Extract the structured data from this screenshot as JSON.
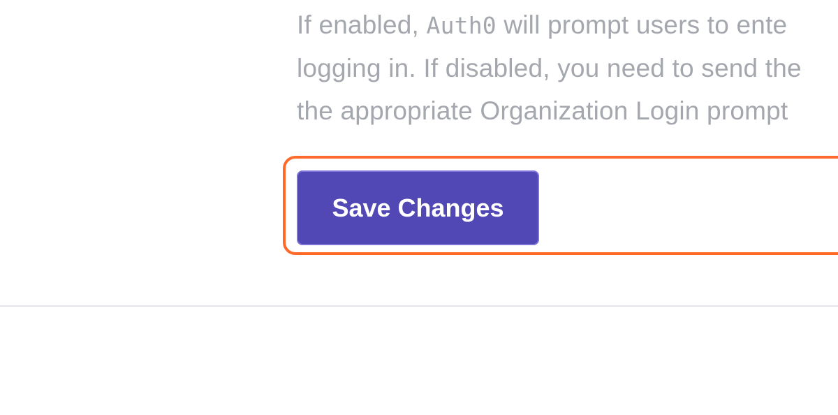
{
  "settings_section": {
    "description_lines": [
      {
        "before": "If enabled, ",
        "mono": "Auth0",
        "after": " will prompt users to ente"
      },
      {
        "text": "logging in. If disabled, you need to send the"
      },
      {
        "text": "the appropriate Organization Login prompt"
      }
    ],
    "save_button_label": "Save Changes"
  },
  "colors": {
    "description_text": "#a4a7ad",
    "button_background": "#5248b5",
    "button_text": "#ffffff",
    "highlight_border": "#ff6a2b",
    "divider": "#e4e5e8"
  }
}
